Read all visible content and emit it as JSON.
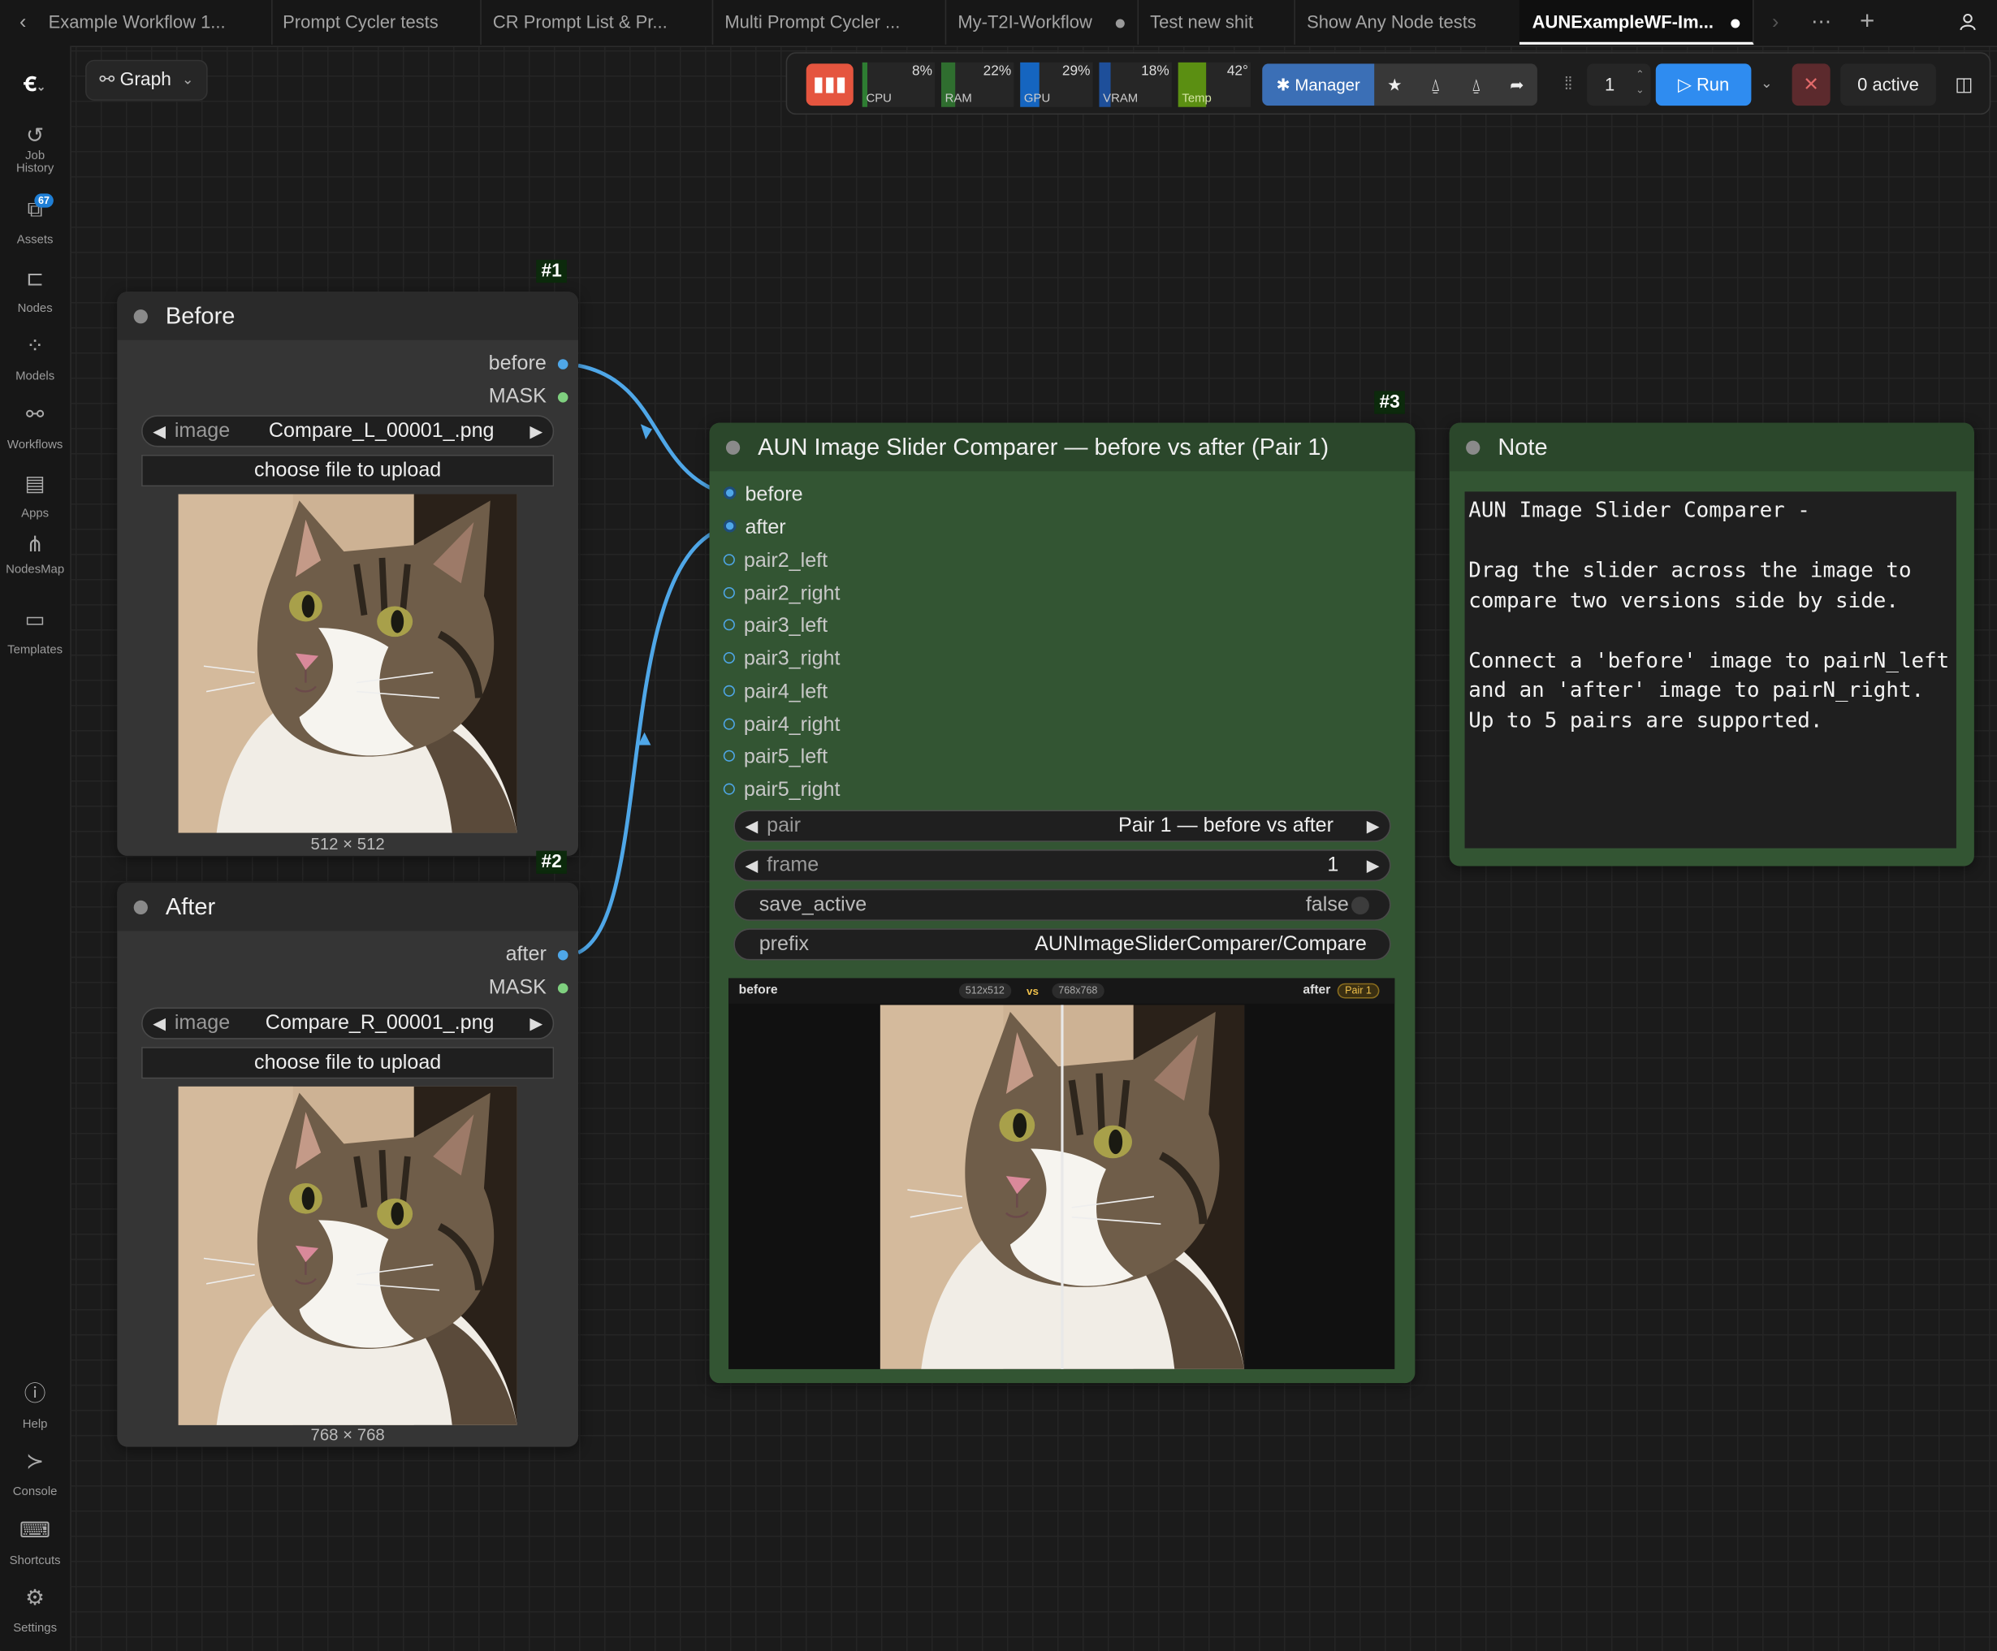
{
  "tabs": [
    {
      "label": "Example Workflow 1..."
    },
    {
      "label": "Prompt Cycler tests"
    },
    {
      "label": "CR Prompt List & Pr..."
    },
    {
      "label": "Multi Prompt Cycler ..."
    },
    {
      "label": "My-T2I-Workflow"
    },
    {
      "label": "Test new shit"
    },
    {
      "label": "Show Any Node tests"
    },
    {
      "label": "AUNExampleWF-Im..."
    }
  ],
  "sidebar": {
    "items": [
      {
        "label": "Job History"
      },
      {
        "label": "Assets",
        "badge": "67"
      },
      {
        "label": "Nodes"
      },
      {
        "label": "Models"
      },
      {
        "label": "Workflows"
      },
      {
        "label": "Apps"
      },
      {
        "label": "NodesMap"
      },
      {
        "label": "Templates"
      },
      {
        "label": "Help"
      },
      {
        "label": "Console"
      },
      {
        "label": "Shortcuts"
      },
      {
        "label": "Settings"
      }
    ]
  },
  "graph_mode": "Graph",
  "monitor": {
    "cpu": {
      "pct": "8%",
      "label": "CPU",
      "value": 8
    },
    "ram": {
      "pct": "22%",
      "label": "RAM",
      "value": 22
    },
    "gpu": {
      "pct": "29%",
      "label": "GPU",
      "value": 29
    },
    "vram": {
      "pct": "18%",
      "label": "VRAM",
      "value": 18
    },
    "temp": {
      "pct": "42°",
      "label": "Temp",
      "value": 42
    }
  },
  "toolbar": {
    "manager_label": "Manager",
    "queue_count": "1",
    "run_label": "Run",
    "active_label": "0 active"
  },
  "nodes": {
    "before": {
      "id": "#1",
      "title": "Before",
      "outputs": [
        "before",
        "MASK"
      ],
      "image_key": "image",
      "image_value": "Compare_L_00001_.png",
      "upload_label": "choose file to upload",
      "dims": "512 × 512"
    },
    "after": {
      "id": "#2",
      "title": "After",
      "outputs": [
        "after",
        "MASK"
      ],
      "image_key": "image",
      "image_value": "Compare_R_00001_.png",
      "upload_label": "choose file to upload",
      "dims": "768 × 768"
    },
    "comparer": {
      "id": "#3",
      "title": "AUN Image Slider Comparer — before vs after (Pair 1)",
      "inputs": [
        "before",
        "after",
        "pair2_left",
        "pair2_right",
        "pair3_left",
        "pair3_right",
        "pair4_left",
        "pair4_right",
        "pair5_left",
        "pair5_right"
      ],
      "widgets": {
        "pair": {
          "key": "pair",
          "value": "Pair 1 — before vs after"
        },
        "frame": {
          "key": "frame",
          "value": "1"
        },
        "save_active": {
          "key": "save_active",
          "value": "false"
        },
        "prefix": {
          "key": "prefix",
          "value": "AUNImageSliderComparer/Compare"
        }
      },
      "preview": {
        "left_label": "before",
        "left_size": "512x512",
        "vs": "vs",
        "right_size": "768x768",
        "right_label": "after",
        "pair_badge": "Pair 1",
        "slider_position": 0.5
      }
    },
    "note": {
      "title": "Note",
      "text": "AUN Image Slider Comparer -\n\nDrag the slider across the image to compare two versions side by side.\n\nConnect a 'before' image to pairN_left and an 'after' image to pairN_right. Up to 5 pairs are supported."
    }
  },
  "colors": {
    "link": "#4fa7e8",
    "group_green": "#335533",
    "run": "#2f8cf0",
    "mask_dot": "#7fd07f"
  }
}
